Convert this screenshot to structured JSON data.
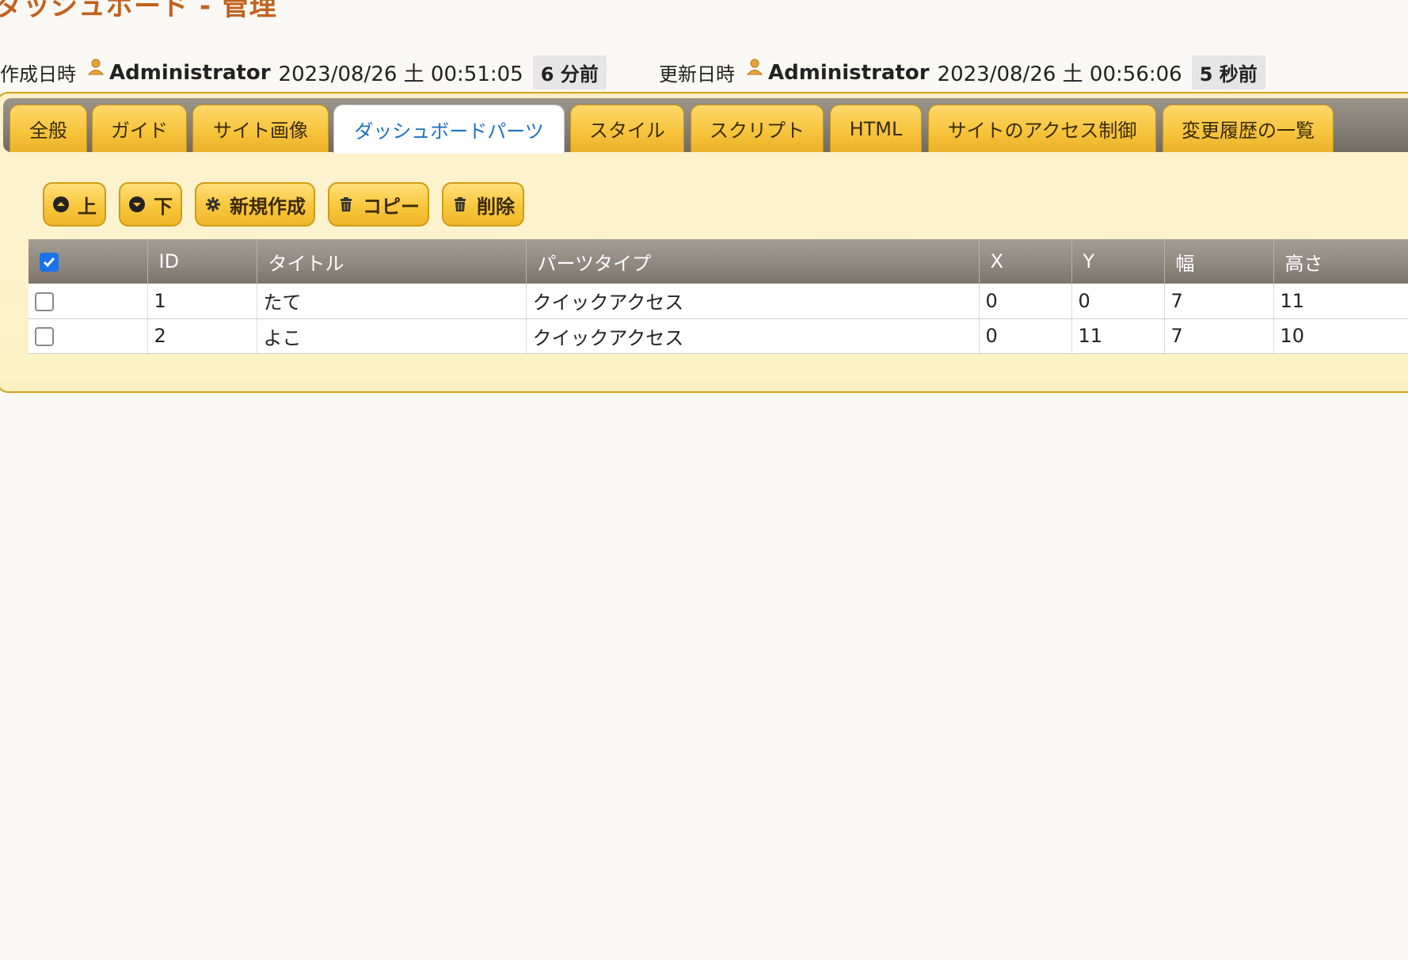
{
  "page": {
    "title": "ダッシュボード - 管理"
  },
  "meta": {
    "created": {
      "label": "作成日時",
      "user": "Administrator",
      "date": "2023/08/26 土 00:51:05",
      "ago": "6 分前"
    },
    "updated": {
      "label": "更新日時",
      "user": "Administrator",
      "date": "2023/08/26 土 00:56:06",
      "ago": "5 秒前"
    }
  },
  "tabs": [
    {
      "label": "全般"
    },
    {
      "label": "ガイド"
    },
    {
      "label": "サイト画像"
    },
    {
      "label": "ダッシュボードパーツ",
      "active": true
    },
    {
      "label": "スタイル"
    },
    {
      "label": "スクリプト"
    },
    {
      "label": "HTML"
    },
    {
      "label": "サイトのアクセス制御"
    },
    {
      "label": "変更履歴の一覧"
    }
  ],
  "toolbar": {
    "up": "上",
    "down": "下",
    "new": "新規作成",
    "copy": "コピー",
    "delete": "削除"
  },
  "table": {
    "columns": [
      "ID",
      "タイトル",
      "パーツタイプ",
      "X",
      "Y",
      "幅",
      "高さ"
    ],
    "header_checked": true,
    "rows": [
      {
        "id": "1",
        "title": "たて",
        "type": "クイックアクセス",
        "x": "0",
        "y": "0",
        "w": "7",
        "h": "11",
        "checked": false
      },
      {
        "id": "2",
        "title": "よこ",
        "type": "クイックアクセス",
        "x": "0",
        "y": "11",
        "w": "7",
        "h": "10",
        "checked": false
      }
    ]
  },
  "colors": {
    "title": "#c0621f",
    "tab": "#f6c33a",
    "active_tab_text": "#1d6fc4",
    "header": "#8f897f",
    "checkbox_checked": "#1a73e8"
  }
}
